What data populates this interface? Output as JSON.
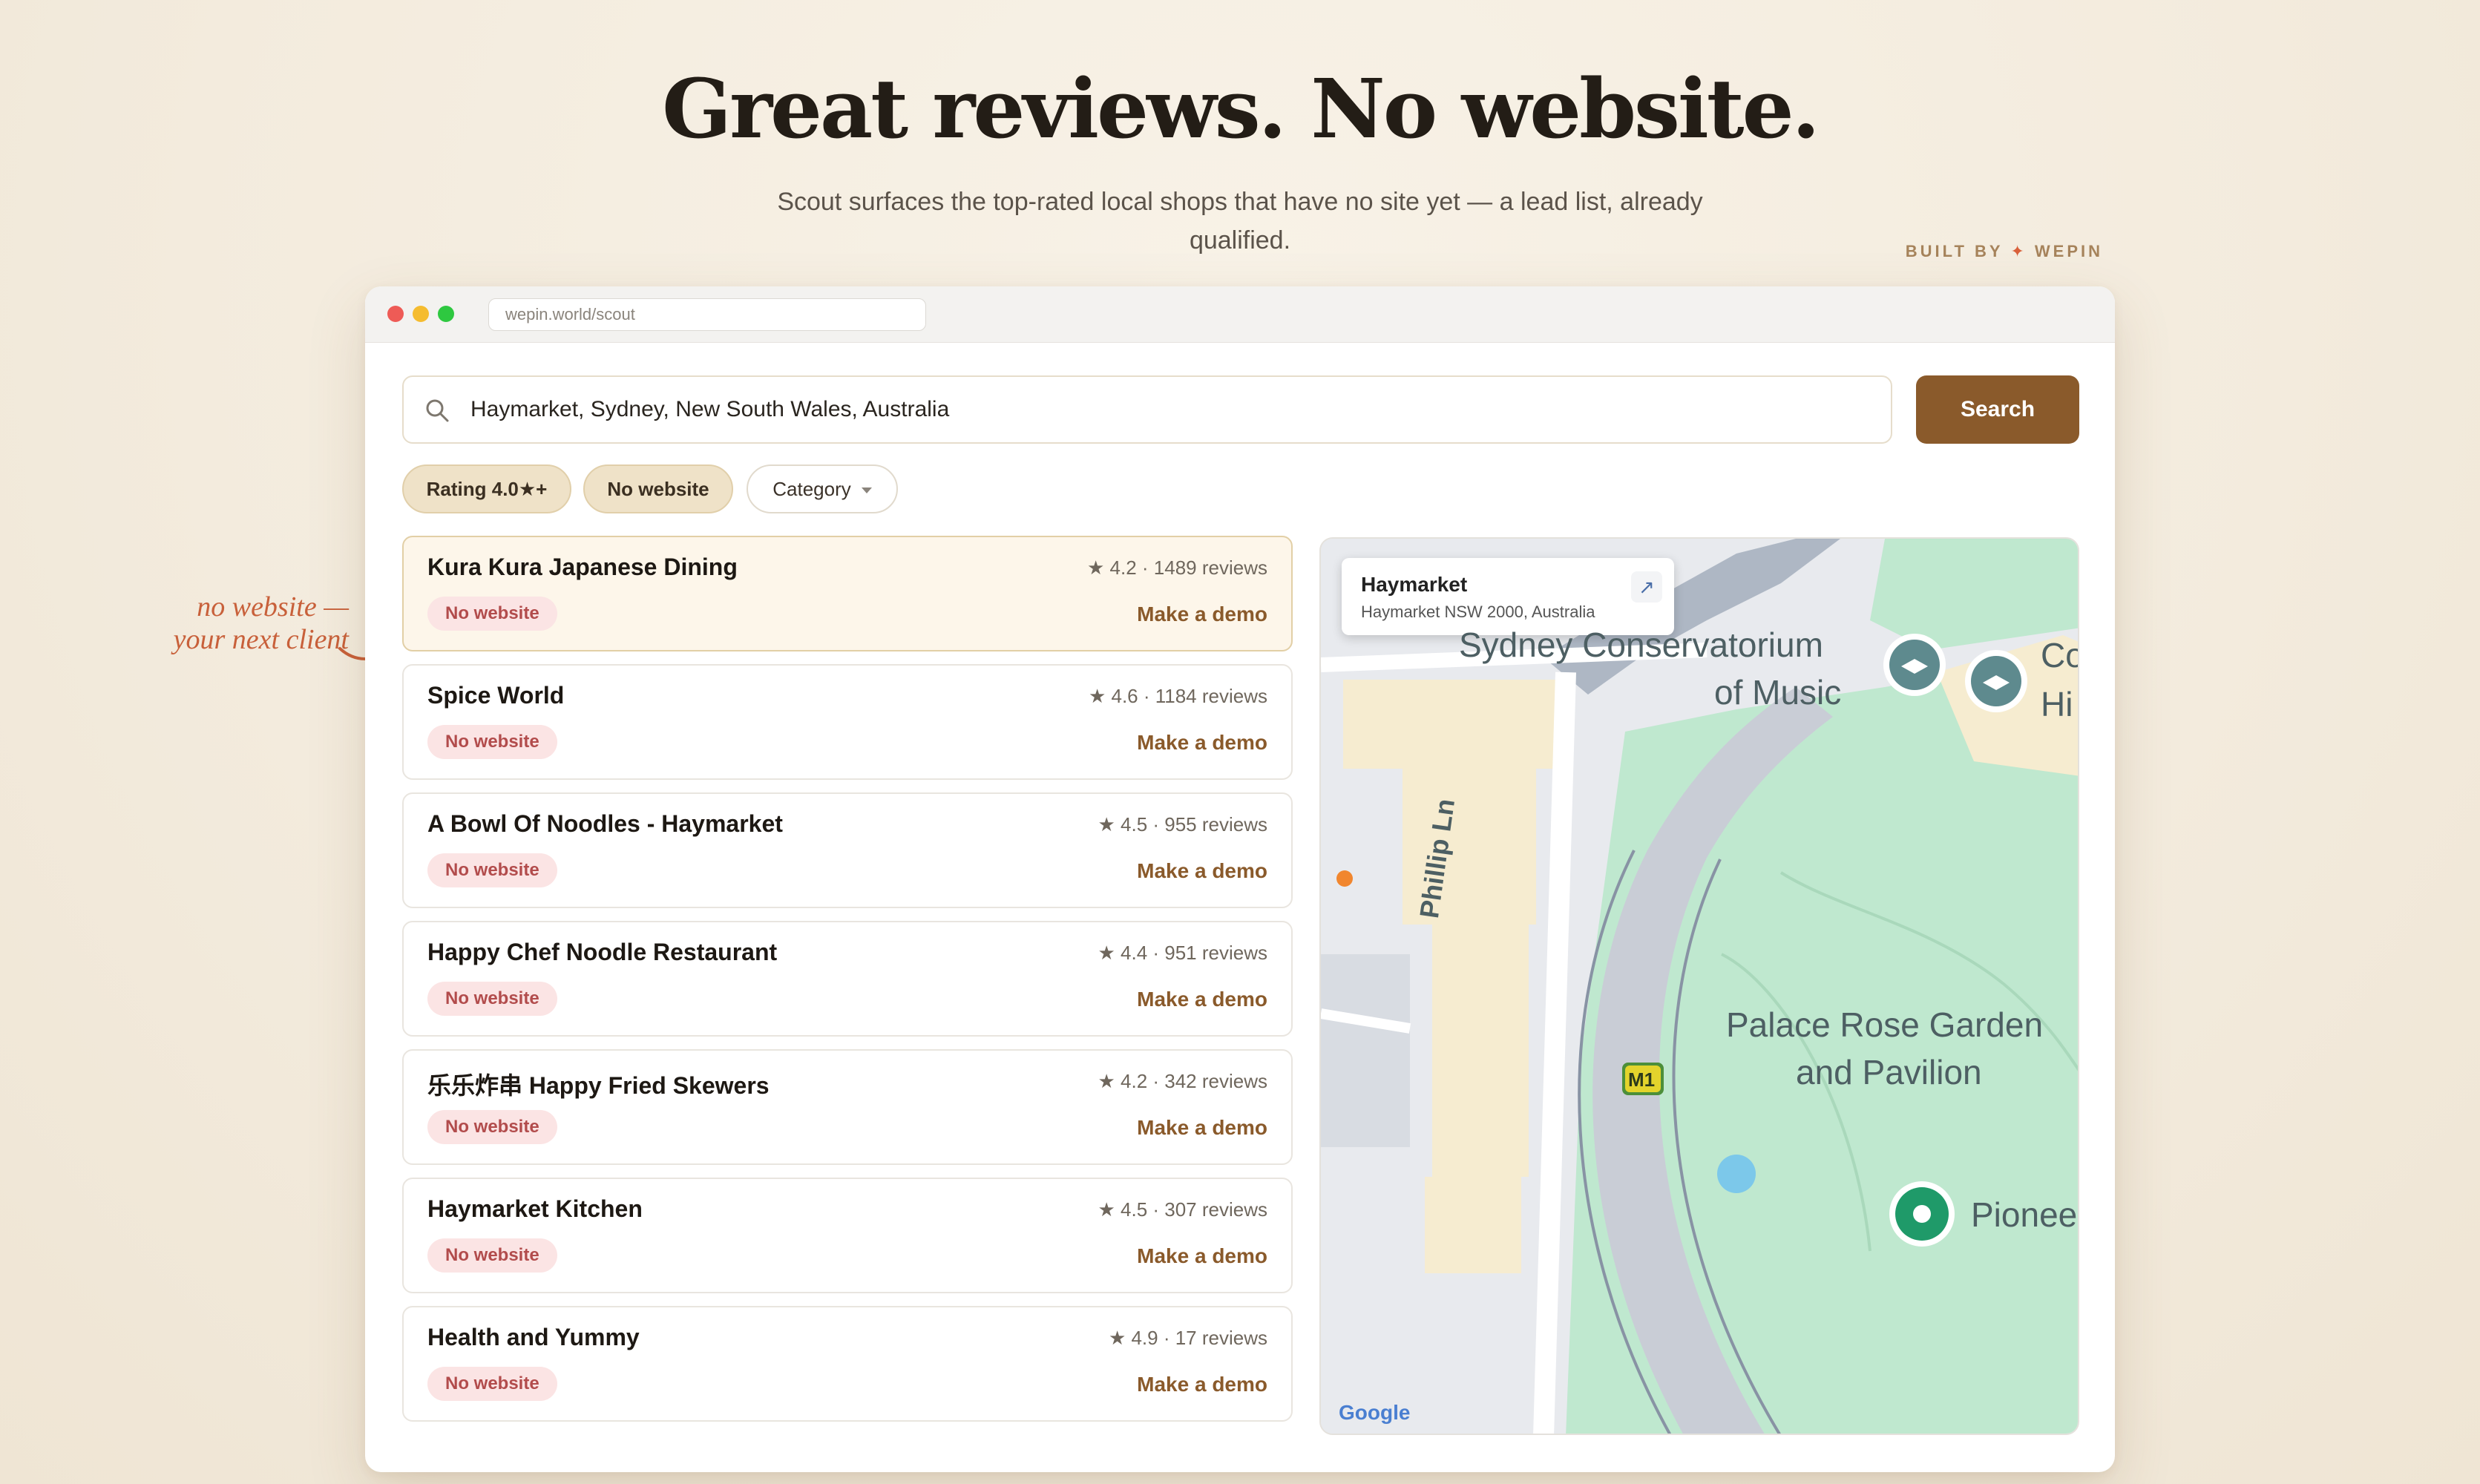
{
  "hero": {
    "title": "Great reviews. No website.",
    "subtitle": "Scout surfaces the top-rated local shops that have no site yet — a lead list, already qualified.",
    "built_by_prefix": "BUILT BY",
    "built_by_brand": "WEPIN",
    "spark": "✦"
  },
  "annotation": {
    "line1": "no website —",
    "line2": "your next client"
  },
  "browser": {
    "url": "wepin.world/scout"
  },
  "search": {
    "value": "Haymarket, Sydney, New South Wales, Australia",
    "button_label": "Search"
  },
  "filters": {
    "rating": "Rating 4.0★+",
    "no_website": "No website",
    "category": "Category"
  },
  "results": [
    {
      "name": "Kura Kura Japanese Dining",
      "rating": "★ 4.2 · 1489 reviews",
      "badge": "No website",
      "action": "Make a demo"
    },
    {
      "name": "Spice World",
      "rating": "★ 4.6 · 1184 reviews",
      "badge": "No website",
      "action": "Make a demo"
    },
    {
      "name": "A Bowl Of Noodles - Haymarket",
      "rating": "★ 4.5 · 955 reviews",
      "badge": "No website",
      "action": "Make a demo"
    },
    {
      "name": "Happy Chef Noodle Restaurant",
      "rating": "★ 4.4 · 951 reviews",
      "badge": "No website",
      "action": "Make a demo"
    },
    {
      "name": "乐乐炸串 Happy Fried Skewers",
      "rating": "★ 4.2 · 342 reviews",
      "badge": "No website",
      "action": "Make a demo"
    },
    {
      "name": "Haymarket Kitchen",
      "rating": "★ 4.5 · 307 reviews",
      "badge": "No website",
      "action": "Make a demo"
    },
    {
      "name": "Health and Yummy",
      "rating": "★ 4.9 · 17 reviews",
      "badge": "No website",
      "action": "Make a demo"
    }
  ],
  "map": {
    "popup_title": "Haymarket",
    "popup_subtitle": "Haymarket NSW 2000, Australia",
    "popup_icon": "↗",
    "label_conservatorium_1": "Sydney Conservatorium",
    "label_conservatorium_2": "of Music",
    "label_garden_1": "Palace Rose Garden",
    "label_garden_2": "and Pavilion",
    "label_street": "Phillip Ln",
    "label_pioneer": "Pionee",
    "label_edge_1": "Co",
    "label_edge_2": "Hi",
    "label_motorway": "M1",
    "attribution": "Google"
  },
  "colors": {
    "accent": "#8a5a2b",
    "badge_bg": "#fbe4e4",
    "badge_text": "#b24c4c",
    "highlight_card": "#fdf6ea",
    "annotation": "#c8603a",
    "park": "#bfe8cf"
  }
}
